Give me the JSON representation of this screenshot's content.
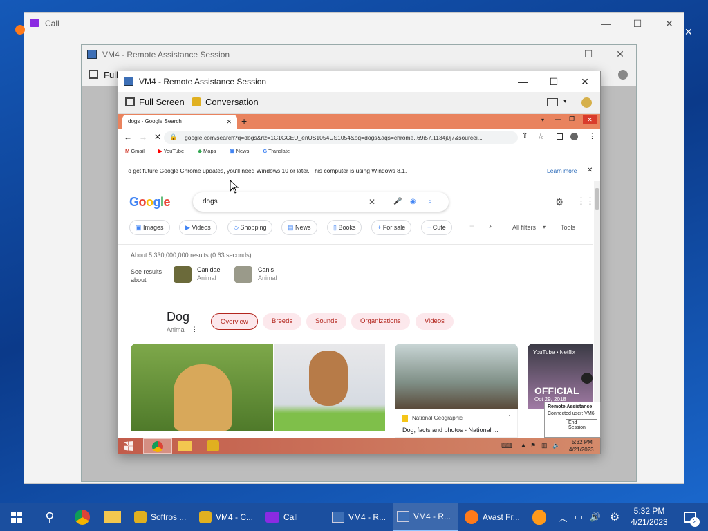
{
  "call_window": {
    "title": "Call"
  },
  "ra_back": {
    "title": "VM4 - Remote Assistance Session",
    "fullscreen_label": "Full"
  },
  "ra_front": {
    "title": "VM4 - Remote Assistance Session",
    "fullscreen_label": "Full Screen",
    "conversation_label": "Conversation"
  },
  "chrome": {
    "tab_title": "dogs - Google Search",
    "url": "google.com/search?q=dogs&rlz=1C1GCEU_enUS1054US1054&oq=dogs&aqs=chrome..69i57.1134j0j7&sourcei...",
    "bookmarks": [
      "Gmail",
      "YouTube",
      "Maps",
      "News",
      "Translate"
    ],
    "infobar_text": "To get future Google Chrome updates, you'll need Windows 10 or later. This computer is using Windows 8.1.",
    "infobar_link": "Learn more"
  },
  "google": {
    "logo": "Google",
    "query": "dogs",
    "chips": [
      "Images",
      "Videos",
      "Shopping",
      "News",
      "Books",
      "For sale",
      "Cute"
    ],
    "all_filters": "All filters",
    "tools": "Tools",
    "results_count": "About 5,330,000,000 results (0.63 seconds)",
    "see_results_about": "See results about",
    "related": [
      {
        "name": "Canidae",
        "type": "Animal"
      },
      {
        "name": "Canis",
        "type": "Animal"
      }
    ],
    "kp_title": "Dog",
    "kp_subtitle": "Animal",
    "kp_tabs": [
      "Overview",
      "Breeds",
      "Sounds",
      "Organizations",
      "Videos"
    ],
    "source_label": "National Geographic",
    "source_snippet": "Dog, facts and photos - National ...",
    "yt_label": "YouTube • Netflix",
    "yt_title": "OFFICIAL",
    "yt_date": "Oct 29, 2018"
  },
  "ra_popup": {
    "title": "Remote Assistance",
    "connected": "Connected user: VM6",
    "end_button": "End Session"
  },
  "inner_clock": {
    "time": "5:32 PM",
    "date": "4/21/2023"
  },
  "taskbar": {
    "items": [
      "Softros ...",
      "VM4 - C...",
      "Call",
      "VM4 - R...",
      "VM4 - R...",
      "Avast Fr..."
    ],
    "time": "5:32 PM",
    "date": "4/21/2023",
    "notif_count": "2"
  }
}
